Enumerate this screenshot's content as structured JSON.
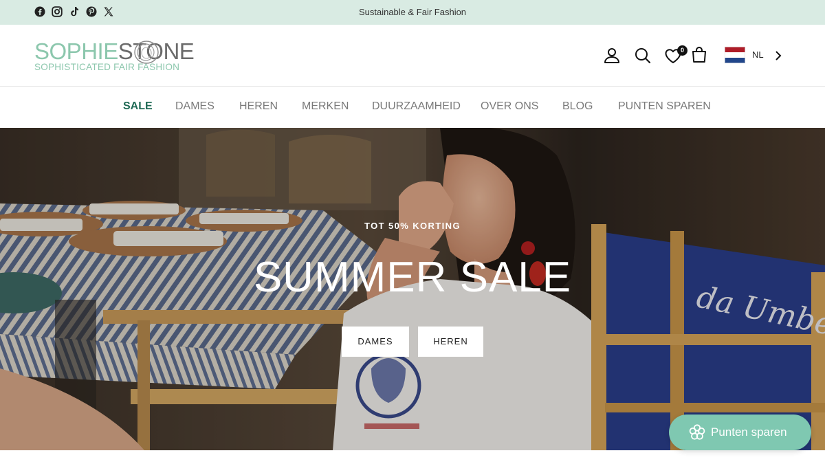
{
  "announcement": {
    "text": "Sustainable & Fair Fashion",
    "social_icons": [
      "facebook-icon",
      "instagram-icon",
      "tiktok-icon",
      "pinterest-icon",
      "x-icon"
    ]
  },
  "header": {
    "logo": {
      "main_part1": "SOPHIE",
      "main_part2": "STONE",
      "tagline": "SOPHISTICATED FAIR FASHION"
    },
    "icons": [
      "account-icon",
      "search-icon",
      "wishlist-icon",
      "cart-icon"
    ],
    "wishlist_count": "0",
    "language": "NL"
  },
  "nav": {
    "items": [
      {
        "label": "SALE",
        "active": true
      },
      {
        "label": "DAMES",
        "active": false
      },
      {
        "label": "HEREN",
        "active": false
      },
      {
        "label": "MERKEN",
        "active": false
      },
      {
        "label": "DUURZAAMHEID",
        "active": false
      },
      {
        "label": "OVER ONS",
        "active": false
      },
      {
        "label": "BLOG",
        "active": false
      },
      {
        "label": "PUNTEN SPAREN",
        "active": false
      }
    ]
  },
  "hero": {
    "kicker": "TOT 50% KORTING",
    "title": "SUMMER SALE",
    "buttons": [
      "DAMES",
      "HEREN"
    ],
    "chair_text": "da Umberto"
  },
  "loyalty": {
    "label": "Punten sparen"
  },
  "colors": {
    "topbar_bg": "#d9ebe3",
    "accent_green": "#1f6a55",
    "logo_mint": "#8cc7ad",
    "loyalty_bg": "#7fc8b1"
  }
}
